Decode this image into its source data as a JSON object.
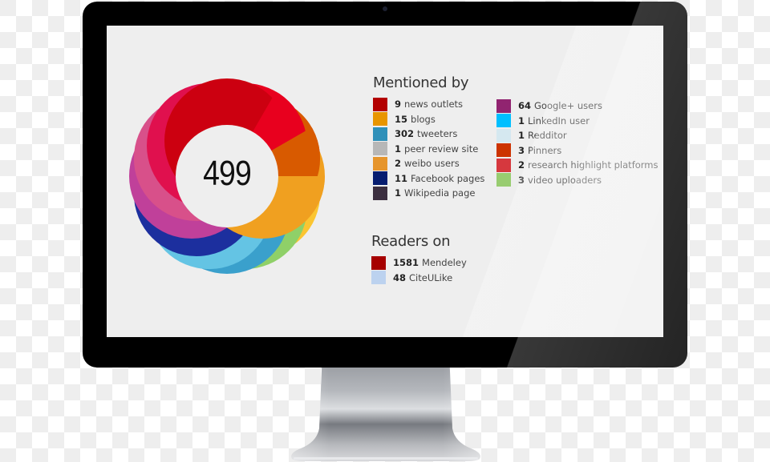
{
  "score": "499",
  "mentioned_by": {
    "title": "Mentioned by",
    "column1": [
      {
        "count": "9",
        "label": "news outlets",
        "color": "#b30000"
      },
      {
        "count": "15",
        "label": "blogs",
        "color": "#e89500"
      },
      {
        "count": "302",
        "label": "tweeters",
        "color": "#2f90b9"
      },
      {
        "count": "1",
        "label": "peer review site",
        "color": "#b7b7b7"
      },
      {
        "count": "2",
        "label": "weibo users",
        "color": "#e6952c"
      },
      {
        "count": "11",
        "label": "Facebook pages",
        "color": "#071d70"
      },
      {
        "count": "1",
        "label": "Wikipedia page",
        "color": "#3c2f40"
      }
    ],
    "column2": [
      {
        "count": "64",
        "label": "Google+ users",
        "color": "#912470"
      },
      {
        "count": "1",
        "label": "LinkedIn user",
        "color": "#00bfff"
      },
      {
        "count": "1",
        "label": "Redditor",
        "color": "#d5e8f0"
      },
      {
        "count": "3",
        "label": "Pinners",
        "color": "#cc3300"
      },
      {
        "count": "2",
        "label": "research highlight platforms",
        "color": "#d6383e"
      },
      {
        "count": "3",
        "label": "video uploaders",
        "color": "#98cc70"
      }
    ]
  },
  "readers_on": {
    "title": "Readers on",
    "items": [
      {
        "count": "1581",
        "label": "Mendeley",
        "color": "#a60000"
      },
      {
        "count": "48",
        "label": "CiteULike",
        "color": "#bcd2ef"
      }
    ]
  },
  "donut_colors": [
    "#e8001e",
    "#d85a00",
    "#f0a020",
    "#fbc531",
    "#8fd068",
    "#3aa0cc",
    "#64c4e4",
    "#1c2f9e",
    "#c0409a",
    "#d8508a",
    "#e0104e",
    "#cc0010"
  ]
}
